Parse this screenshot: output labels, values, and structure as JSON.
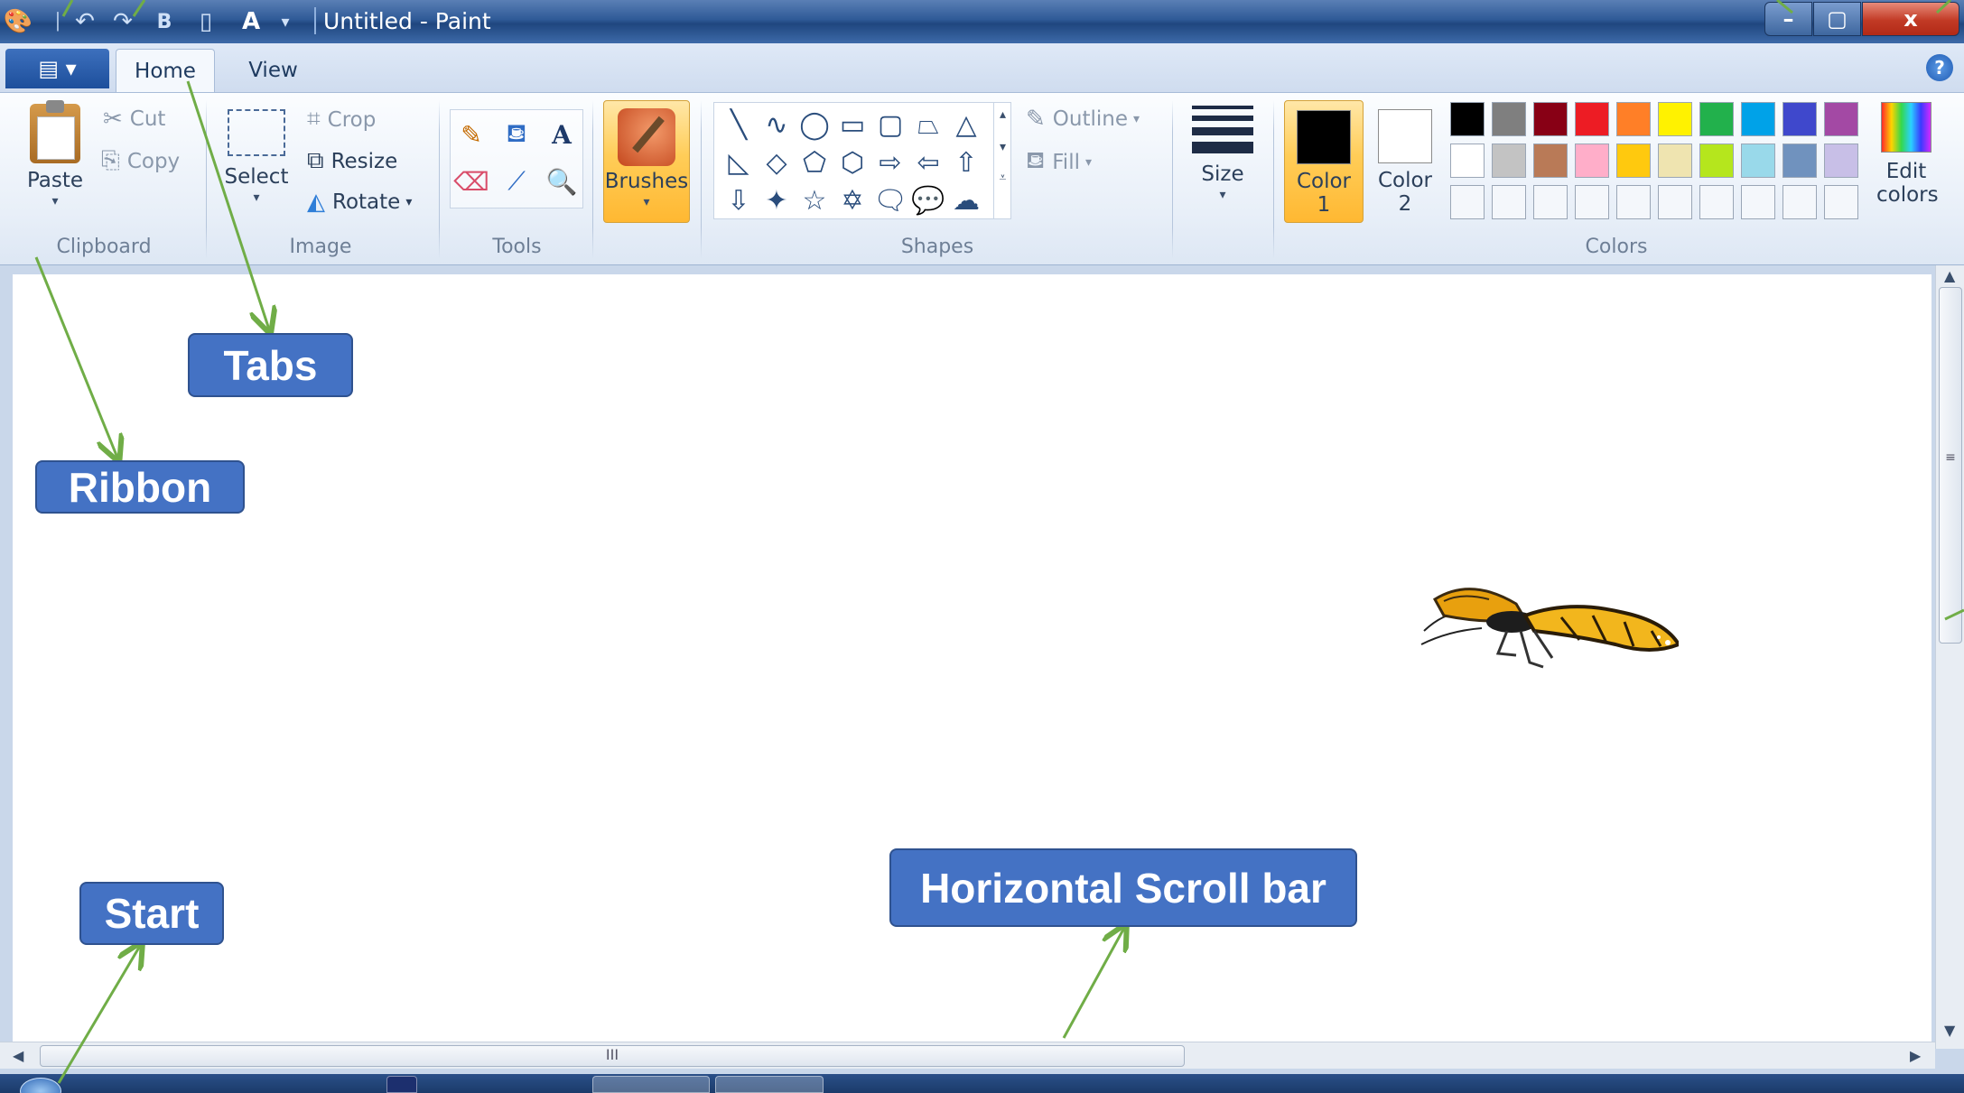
{
  "window": {
    "title": "Untitled - Paint",
    "controls": {
      "minimize": "–",
      "maximize": "▢",
      "close": "x"
    }
  },
  "quick_access": {
    "icons": [
      "paint-app-icon",
      "undo-icon",
      "redo-icon",
      "bold-icon",
      "new-file-icon",
      "text-icon",
      "customize-dropdown-icon"
    ]
  },
  "tabs": {
    "menu_button": "▤ ▾",
    "home": "Home",
    "view": "View",
    "help": "?"
  },
  "ribbon": {
    "clipboard": {
      "label": "Clipboard",
      "paste": "Paste",
      "cut": "Cut",
      "copy": "Copy"
    },
    "image": {
      "label": "Image",
      "select": "Select",
      "crop": "Crop",
      "resize": "Resize",
      "rotate": "Rotate"
    },
    "tools": {
      "label": "Tools",
      "items": [
        "pencil-icon",
        "fill-bucket-icon",
        "text-tool-icon",
        "eraser-icon",
        "color-picker-icon",
        "magnifier-icon"
      ]
    },
    "brushes": {
      "label": "Brushes"
    },
    "shapes": {
      "label": "Shapes",
      "glyphs": [
        "╲",
        "∿",
        "◯",
        "▭",
        "▢",
        "⏢",
        "△",
        "◺",
        "◇",
        "⬠",
        "⬡",
        "⇨",
        "⇦",
        "⇧",
        "⇩",
        "✦",
        "☆",
        "✡",
        "🗨",
        "💬",
        "☁"
      ],
      "outline": "Outline",
      "fill": "Fill"
    },
    "size": {
      "label": "Size"
    },
    "colors": {
      "label": "Colors",
      "color1_label": "Color",
      "color1_num": "1",
      "color2_label": "Color",
      "color2_num": "2",
      "color1_value": "#000000",
      "color2_value": "#ffffff",
      "edit_line1": "Edit",
      "edit_line2": "colors",
      "palette_row1": [
        "#000000",
        "#7f7f7f",
        "#880015",
        "#ed1c24",
        "#ff7f27",
        "#fff200",
        "#22b14c",
        "#00a2e8",
        "#3f48cc",
        "#a349a4"
      ],
      "palette_row2": [
        "#ffffff",
        "#c3c3c3",
        "#b97a57",
        "#ffaec9",
        "#ffc90e",
        "#efe4b0",
        "#b5e61d",
        "#99d9ea",
        "#7092be",
        "#c8bfe7"
      ]
    }
  },
  "scrollbars": {
    "h_grip": "III",
    "v_grip": "≡"
  },
  "annotations": {
    "tabs": "Tabs",
    "ribbon": "Ribbon",
    "start": "Start",
    "hscroll": "Horizontal Scroll bar"
  }
}
